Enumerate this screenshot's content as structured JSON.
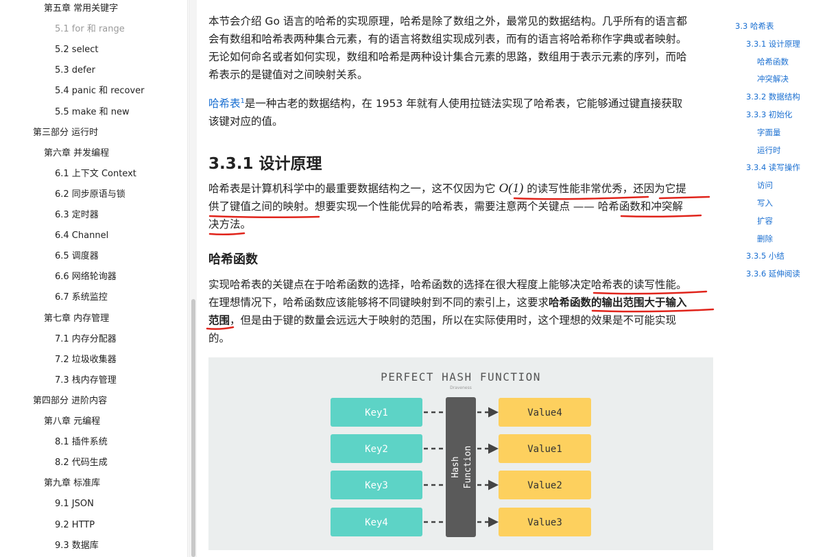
{
  "sidebar": {
    "items": [
      {
        "label": "第五章 常用关键字",
        "level": 2
      },
      {
        "label": "5.1 for 和 range",
        "level": 3,
        "active": true
      },
      {
        "label": "5.2 select",
        "level": 3
      },
      {
        "label": "5.3 defer",
        "level": 3
      },
      {
        "label": "5.4 panic 和 recover",
        "level": 3
      },
      {
        "label": "5.5 make 和 new",
        "level": 3
      },
      {
        "label": "第三部分 运行时",
        "level": 1
      },
      {
        "label": "第六章 并发编程",
        "level": 2
      },
      {
        "label": "6.1 上下文 Context",
        "level": 3
      },
      {
        "label": "6.2 同步原语与锁",
        "level": 3
      },
      {
        "label": "6.3 定时器",
        "level": 3
      },
      {
        "label": "6.4 Channel",
        "level": 3
      },
      {
        "label": "6.5 调度器",
        "level": 3
      },
      {
        "label": "6.6 网络轮询器",
        "level": 3
      },
      {
        "label": "6.7 系统监控",
        "level": 3
      },
      {
        "label": "第七章 内存管理",
        "level": 2
      },
      {
        "label": "7.1 内存分配器",
        "level": 3
      },
      {
        "label": "7.2 垃圾收集器",
        "level": 3
      },
      {
        "label": "7.3 栈内存管理",
        "level": 3
      },
      {
        "label": "第四部分 进阶内容",
        "level": 1
      },
      {
        "label": "第八章 元编程",
        "level": 2
      },
      {
        "label": "8.1 插件系统",
        "level": 3
      },
      {
        "label": "8.2 代码生成",
        "level": 3
      },
      {
        "label": "第九章 标准库",
        "level": 2
      },
      {
        "label": "9.1 JSON",
        "level": 3
      },
      {
        "label": "9.2 HTTP",
        "level": 3
      },
      {
        "label": "9.3 数据库",
        "level": 3
      }
    ]
  },
  "content": {
    "intro_line1": "本节会介绍 Go 语言的哈希的实现原理，哈希是除了数组之外，最常见的数据结构。几乎所有的语言都",
    "intro_line2": "会有数组和哈希表两种集合元素，有的语言将数组实现成列表，而有的语言将哈希称作字典或者映射。",
    "intro_line3": "无论如何命名或者如何实现，数组和哈希是两种设计集合元素的思路，数组用于表示元素的序列，而哈",
    "intro_line4": "希表示的是键值对之间映射关系。",
    "hashtable_link": "哈希表",
    "footnote_ref": "1",
    "hashtable_line1": "是一种古老的数据结构，在 1953 年就有人使用拉链法实现了哈希表，它能够通过键直接获取",
    "hashtable_line2": "该键对应的值。",
    "section_title": "3.3.1 设计原理",
    "design_line1_pre": "哈希表是计算机科学中的最重要数据结构之一，这不仅因为它 ",
    "design_math": "O(1)",
    "design_line1_post": " 的读写性能非常优秀，还因为它提",
    "design_line2": "供了键值之间的映射。想要实现一个性能优异的哈希表，需要注意两个关键点 —— 哈希函数和冲突解",
    "design_line3": "决方法。",
    "subsection_title": "哈希函数",
    "hash_line1": "实现哈希表的关键点在于哈希函数的选择，哈希函数的选择在很大程度上能够决定哈希表的读写性能。",
    "hash_line2_pre": "在理想情况下，哈希函数应该能够将不同键映射到不同的索引上，这要求",
    "hash_line2_bold": "哈希函数的输出范围大于输入",
    "hash_line3_bold": "范围",
    "hash_line3_post": "，但是由于键的数量会远远大于映射的范围，所以在实际使用时，这个理想的效果是不可能实现",
    "hash_line4": "的。"
  },
  "diagram": {
    "title": "PERFECT HASH FUNCTION",
    "watermark": "Draveness",
    "function_label_1": "Hash",
    "function_label_2": "Function",
    "keys": [
      "Key1",
      "Key2",
      "Key3",
      "Key4"
    ],
    "values": [
      "Value4",
      "Value1",
      "Value2",
      "Value3"
    ],
    "key_color": "#5dd3c6",
    "value_color": "#fdd05e",
    "function_color": "#5a5a5a"
  },
  "right_toc": {
    "items": [
      {
        "label": "3.3 哈希表",
        "level": 1
      },
      {
        "label": "3.3.1 设计原理",
        "level": 2
      },
      {
        "label": "哈希函数",
        "level": 3
      },
      {
        "label": "冲突解决",
        "level": 3
      },
      {
        "label": "3.3.2 数据结构",
        "level": 2
      },
      {
        "label": "3.3.3 初始化",
        "level": 2
      },
      {
        "label": "字面量",
        "level": 3
      },
      {
        "label": "运行时",
        "level": 3
      },
      {
        "label": "3.3.4 读写操作",
        "level": 2
      },
      {
        "label": "访问",
        "level": 3
      },
      {
        "label": "写入",
        "level": 3
      },
      {
        "label": "扩容",
        "level": 3
      },
      {
        "label": "删除",
        "level": 3
      },
      {
        "label": "3.3.5 小结",
        "level": 2
      },
      {
        "label": "3.3.6 延伸阅读",
        "level": 2
      }
    ]
  },
  "colors": {
    "link": "#1a6fd1",
    "annotation": "#e0241b"
  }
}
